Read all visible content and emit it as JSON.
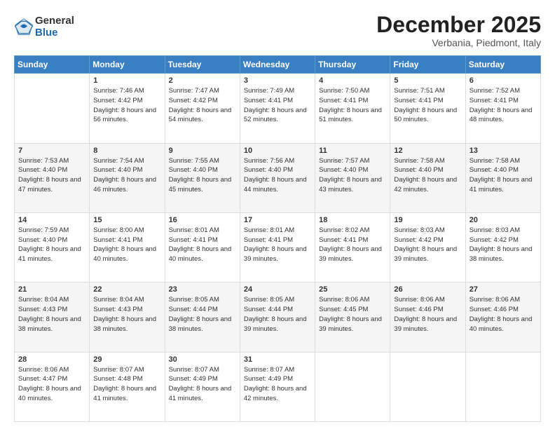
{
  "header": {
    "logo_general": "General",
    "logo_blue": "Blue",
    "month_title": "December 2025",
    "subtitle": "Verbania, Piedmont, Italy"
  },
  "days_of_week": [
    "Sunday",
    "Monday",
    "Tuesday",
    "Wednesday",
    "Thursday",
    "Friday",
    "Saturday"
  ],
  "weeks": [
    [
      {
        "day": "",
        "sunrise": "",
        "sunset": "",
        "daylight": ""
      },
      {
        "day": "1",
        "sunrise": "Sunrise: 7:46 AM",
        "sunset": "Sunset: 4:42 PM",
        "daylight": "Daylight: 8 hours and 56 minutes."
      },
      {
        "day": "2",
        "sunrise": "Sunrise: 7:47 AM",
        "sunset": "Sunset: 4:42 PM",
        "daylight": "Daylight: 8 hours and 54 minutes."
      },
      {
        "day": "3",
        "sunrise": "Sunrise: 7:49 AM",
        "sunset": "Sunset: 4:41 PM",
        "daylight": "Daylight: 8 hours and 52 minutes."
      },
      {
        "day": "4",
        "sunrise": "Sunrise: 7:50 AM",
        "sunset": "Sunset: 4:41 PM",
        "daylight": "Daylight: 8 hours and 51 minutes."
      },
      {
        "day": "5",
        "sunrise": "Sunrise: 7:51 AM",
        "sunset": "Sunset: 4:41 PM",
        "daylight": "Daylight: 8 hours and 50 minutes."
      },
      {
        "day": "6",
        "sunrise": "Sunrise: 7:52 AM",
        "sunset": "Sunset: 4:41 PM",
        "daylight": "Daylight: 8 hours and 48 minutes."
      }
    ],
    [
      {
        "day": "7",
        "sunrise": "Sunrise: 7:53 AM",
        "sunset": "Sunset: 4:40 PM",
        "daylight": "Daylight: 8 hours and 47 minutes."
      },
      {
        "day": "8",
        "sunrise": "Sunrise: 7:54 AM",
        "sunset": "Sunset: 4:40 PM",
        "daylight": "Daylight: 8 hours and 46 minutes."
      },
      {
        "day": "9",
        "sunrise": "Sunrise: 7:55 AM",
        "sunset": "Sunset: 4:40 PM",
        "daylight": "Daylight: 8 hours and 45 minutes."
      },
      {
        "day": "10",
        "sunrise": "Sunrise: 7:56 AM",
        "sunset": "Sunset: 4:40 PM",
        "daylight": "Daylight: 8 hours and 44 minutes."
      },
      {
        "day": "11",
        "sunrise": "Sunrise: 7:57 AM",
        "sunset": "Sunset: 4:40 PM",
        "daylight": "Daylight: 8 hours and 43 minutes."
      },
      {
        "day": "12",
        "sunrise": "Sunrise: 7:58 AM",
        "sunset": "Sunset: 4:40 PM",
        "daylight": "Daylight: 8 hours and 42 minutes."
      },
      {
        "day": "13",
        "sunrise": "Sunrise: 7:58 AM",
        "sunset": "Sunset: 4:40 PM",
        "daylight": "Daylight: 8 hours and 41 minutes."
      }
    ],
    [
      {
        "day": "14",
        "sunrise": "Sunrise: 7:59 AM",
        "sunset": "Sunset: 4:40 PM",
        "daylight": "Daylight: 8 hours and 41 minutes."
      },
      {
        "day": "15",
        "sunrise": "Sunrise: 8:00 AM",
        "sunset": "Sunset: 4:41 PM",
        "daylight": "Daylight: 8 hours and 40 minutes."
      },
      {
        "day": "16",
        "sunrise": "Sunrise: 8:01 AM",
        "sunset": "Sunset: 4:41 PM",
        "daylight": "Daylight: 8 hours and 40 minutes."
      },
      {
        "day": "17",
        "sunrise": "Sunrise: 8:01 AM",
        "sunset": "Sunset: 4:41 PM",
        "daylight": "Daylight: 8 hours and 39 minutes."
      },
      {
        "day": "18",
        "sunrise": "Sunrise: 8:02 AM",
        "sunset": "Sunset: 4:41 PM",
        "daylight": "Daylight: 8 hours and 39 minutes."
      },
      {
        "day": "19",
        "sunrise": "Sunrise: 8:03 AM",
        "sunset": "Sunset: 4:42 PM",
        "daylight": "Daylight: 8 hours and 39 minutes."
      },
      {
        "day": "20",
        "sunrise": "Sunrise: 8:03 AM",
        "sunset": "Sunset: 4:42 PM",
        "daylight": "Daylight: 8 hours and 38 minutes."
      }
    ],
    [
      {
        "day": "21",
        "sunrise": "Sunrise: 8:04 AM",
        "sunset": "Sunset: 4:43 PM",
        "daylight": "Daylight: 8 hours and 38 minutes."
      },
      {
        "day": "22",
        "sunrise": "Sunrise: 8:04 AM",
        "sunset": "Sunset: 4:43 PM",
        "daylight": "Daylight: 8 hours and 38 minutes."
      },
      {
        "day": "23",
        "sunrise": "Sunrise: 8:05 AM",
        "sunset": "Sunset: 4:44 PM",
        "daylight": "Daylight: 8 hours and 38 minutes."
      },
      {
        "day": "24",
        "sunrise": "Sunrise: 8:05 AM",
        "sunset": "Sunset: 4:44 PM",
        "daylight": "Daylight: 8 hours and 39 minutes."
      },
      {
        "day": "25",
        "sunrise": "Sunrise: 8:06 AM",
        "sunset": "Sunset: 4:45 PM",
        "daylight": "Daylight: 8 hours and 39 minutes."
      },
      {
        "day": "26",
        "sunrise": "Sunrise: 8:06 AM",
        "sunset": "Sunset: 4:46 PM",
        "daylight": "Daylight: 8 hours and 39 minutes."
      },
      {
        "day": "27",
        "sunrise": "Sunrise: 8:06 AM",
        "sunset": "Sunset: 4:46 PM",
        "daylight": "Daylight: 8 hours and 40 minutes."
      }
    ],
    [
      {
        "day": "28",
        "sunrise": "Sunrise: 8:06 AM",
        "sunset": "Sunset: 4:47 PM",
        "daylight": "Daylight: 8 hours and 40 minutes."
      },
      {
        "day": "29",
        "sunrise": "Sunrise: 8:07 AM",
        "sunset": "Sunset: 4:48 PM",
        "daylight": "Daylight: 8 hours and 41 minutes."
      },
      {
        "day": "30",
        "sunrise": "Sunrise: 8:07 AM",
        "sunset": "Sunset: 4:49 PM",
        "daylight": "Daylight: 8 hours and 41 minutes."
      },
      {
        "day": "31",
        "sunrise": "Sunrise: 8:07 AM",
        "sunset": "Sunset: 4:49 PM",
        "daylight": "Daylight: 8 hours and 42 minutes."
      },
      {
        "day": "",
        "sunrise": "",
        "sunset": "",
        "daylight": ""
      },
      {
        "day": "",
        "sunrise": "",
        "sunset": "",
        "daylight": ""
      },
      {
        "day": "",
        "sunrise": "",
        "sunset": "",
        "daylight": ""
      }
    ]
  ]
}
